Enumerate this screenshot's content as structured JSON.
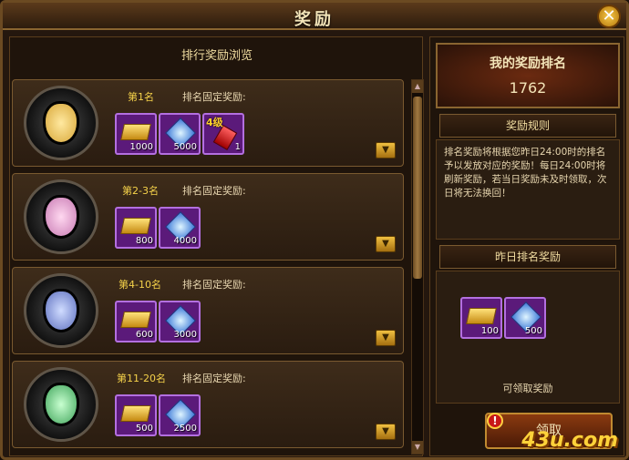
{
  "window": {
    "title": "奖励",
    "close_label": "✕"
  },
  "left": {
    "header": "排行奖励浏览",
    "fixed_reward_label": "排名固定奖励:",
    "rows": [
      {
        "rank": "第1名",
        "medal_color": "#d8a637",
        "rewards": [
          {
            "type": "gold",
            "qty": "1000"
          },
          {
            "type": "gem",
            "qty": "5000"
          },
          {
            "type": "red",
            "qty": "1",
            "badge": "4级"
          }
        ]
      },
      {
        "rank": "第2-3名",
        "medal_color": "#c87ab3",
        "rewards": [
          {
            "type": "gold",
            "qty": "800"
          },
          {
            "type": "gem",
            "qty": "4000"
          }
        ]
      },
      {
        "rank": "第4-10名",
        "medal_color": "#5d6fbf",
        "rewards": [
          {
            "type": "gold",
            "qty": "600"
          },
          {
            "type": "gem",
            "qty": "3000"
          }
        ]
      },
      {
        "rank": "第11-20名",
        "medal_color": "#3fa45a",
        "rewards": [
          {
            "type": "gold",
            "qty": "500"
          },
          {
            "type": "gem",
            "qty": "2500"
          }
        ]
      }
    ]
  },
  "right": {
    "my_rank_title": "我的奖励排名",
    "my_rank_value": "1762",
    "rules_title": "奖励规则",
    "rules_text": "排名奖励将根据您昨日24:00时的排名予以发放对应的奖励！每日24:00时将刷新奖励，若当日奖励未及时领取，次日将无法换回！",
    "yesterday_title": "昨日排名奖励",
    "yesterday_rewards": [
      {
        "type": "gold",
        "qty": "100"
      },
      {
        "type": "gem",
        "qty": "500"
      }
    ],
    "claimable_text": "可领取奖励",
    "claim_label": "领取",
    "alert": "!"
  },
  "watermark": "43u.com"
}
